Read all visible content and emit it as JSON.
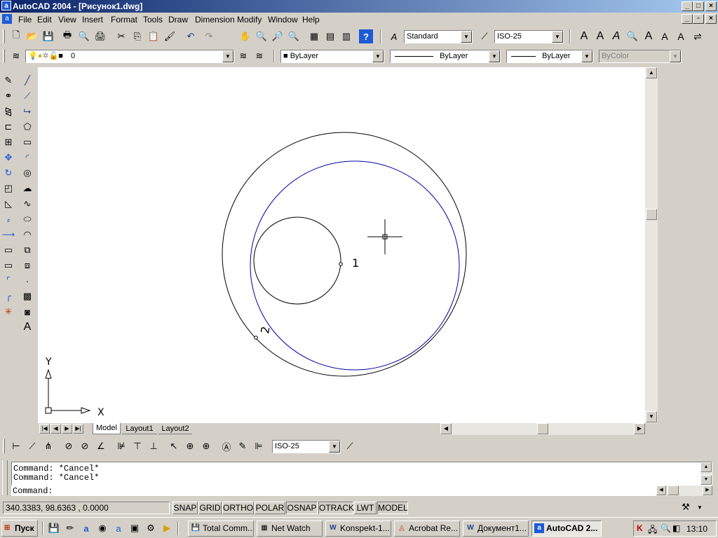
{
  "window": {
    "title": "AutoCAD 2004 - [Рисунок1.dwg]",
    "app_icon": "a"
  },
  "menu": [
    "File",
    "Edit",
    "View",
    "Insert",
    "Format",
    "Tools",
    "Draw",
    "Dimension",
    "Modify",
    "Window",
    "Help"
  ],
  "toolbars": {
    "text_style": "Standard",
    "dim_style": "ISO-25",
    "layer": "0",
    "color": "ByLayer",
    "linetype": "ByLayer",
    "lineweight": "ByLayer",
    "plotstyle": "ByColor",
    "dim_toolbar_style": "ISO-25"
  },
  "drawing": {
    "label_1": "1",
    "label_2": "2",
    "ucs_x": "X",
    "ucs_y": "Y",
    "circle_colors": {
      "outer": "#000000",
      "inner": "#000000",
      "tangent": "#0000a0"
    }
  },
  "tabs": {
    "model": "Model",
    "layout1": "Layout1",
    "layout2": "Layout2"
  },
  "command": {
    "history": [
      "Command:  *Cancel*",
      "Command:  *Cancel*"
    ],
    "prompt": "Command:"
  },
  "status": {
    "coords": "340.3383, 98.6363 , 0.0000",
    "buttons": [
      "SNAP",
      "GRID",
      "ORTHO",
      "POLAR",
      "OSNAP",
      "OTRACK",
      "LWT",
      "MODEL"
    ]
  },
  "taskbar": {
    "start": "Пуск",
    "tasks": [
      "Total Comm...",
      "Net Watch",
      "Konspekt-1...",
      "Acrobat Re...",
      "Документ1...",
      "AutoCAD 2..."
    ],
    "clock": "13:10"
  }
}
